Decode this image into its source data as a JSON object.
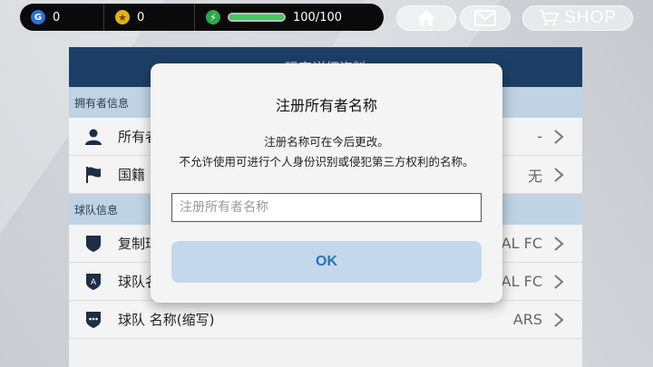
{
  "topbar": {
    "gp_value": "0",
    "coin_value": "0",
    "energy_label": "100/100",
    "energy_fraction": 1.0,
    "shop_label": "SHOP"
  },
  "panel": {
    "title": "玩家详细资料",
    "owner_section": "拥有者信息",
    "owner_rows": [
      {
        "label": "所有者",
        "value": "-"
      },
      {
        "label": "国籍",
        "value": "无"
      }
    ],
    "team_section": "球队信息",
    "team_rows": [
      {
        "label": "复制球队",
        "value": "AL FC"
      },
      {
        "label": "球队名称",
        "value": "AL FC"
      },
      {
        "label": "球队 名称(缩写)",
        "value": "ARS"
      }
    ]
  },
  "modal": {
    "title": "注册所有者名称",
    "message_line1": "注册名称可在今后更改。",
    "message_line2": "不允许使用可进行个人身份识别或侵犯第三方权利的名称。",
    "input_placeholder": "注册所有者名称",
    "input_value": "",
    "ok_label": "OK"
  },
  "colors": {
    "panel_header": "#1d3f66",
    "section_header": "#bfd3e4",
    "ok_button_bg": "#c3d8ea",
    "ok_button_text": "#2d72b8",
    "energy": "#3ecf5b"
  }
}
